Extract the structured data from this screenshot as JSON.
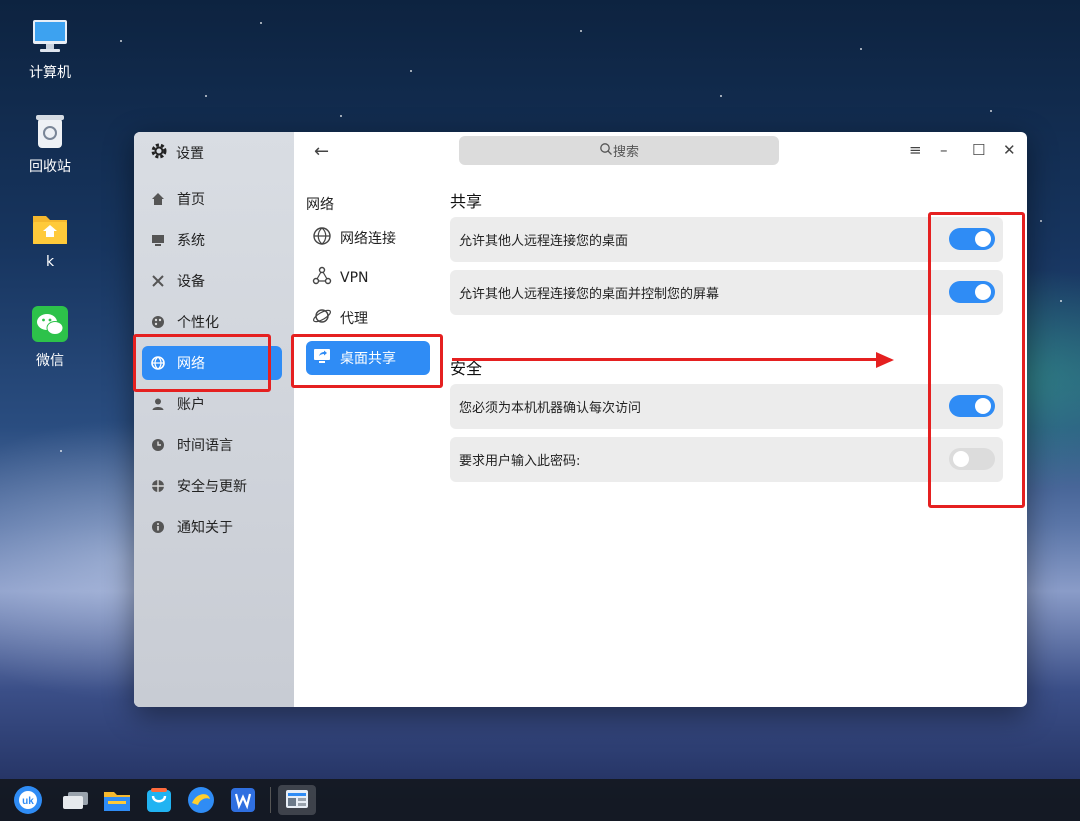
{
  "desktop": {
    "icons": [
      {
        "label": "计算机",
        "icon": "computer-icon"
      },
      {
        "label": "回收站",
        "icon": "trash-icon"
      },
      {
        "label": "k",
        "icon": "folder-icon"
      },
      {
        "label": "微信",
        "icon": "wechat-icon"
      }
    ]
  },
  "window": {
    "app_title": "设置",
    "search_placeholder": "搜索",
    "sidebar": {
      "items": [
        {
          "label": "首页",
          "icon": "home-icon"
        },
        {
          "label": "系统",
          "icon": "monitor-icon"
        },
        {
          "label": "设备",
          "icon": "tools-icon"
        },
        {
          "label": "个性化",
          "icon": "palette-icon"
        },
        {
          "label": "网络",
          "icon": "globe-icon",
          "active": true
        },
        {
          "label": "账户",
          "icon": "user-icon"
        },
        {
          "label": "时间语言",
          "icon": "clock-icon"
        },
        {
          "label": "安全与更新",
          "icon": "shield-icon"
        },
        {
          "label": "通知关于",
          "icon": "info-icon"
        }
      ]
    },
    "middle": {
      "heading": "网络",
      "items": [
        {
          "label": "网络连接",
          "icon": "network-globe-icon"
        },
        {
          "label": "VPN",
          "icon": "vpn-nodes-icon"
        },
        {
          "label": "代理",
          "icon": "proxy-planet-icon"
        },
        {
          "label": "桌面共享",
          "icon": "desktop-share-icon",
          "active": true
        }
      ]
    },
    "content": {
      "share_title": "共享",
      "share_rows": [
        {
          "label": "允许其他人远程连接您的桌面",
          "enabled": true
        },
        {
          "label": "允许其他人远程连接您的桌面并控制您的屏幕",
          "enabled": true
        }
      ],
      "security_title": "安全",
      "security_rows": [
        {
          "label": "您必须为本机机器确认每次访问",
          "enabled": true
        },
        {
          "label": "要求用户输入此密码:",
          "enabled": false
        }
      ]
    }
  },
  "colors": {
    "accent": "#2f8cf5",
    "annotation": "#e52020"
  },
  "taskbar": {
    "apps": [
      "start-menu-icon",
      "multitask-icon",
      "file-manager-icon",
      "app-store-icon",
      "browser-icon",
      "wps-icon",
      "system-monitor-icon"
    ]
  }
}
